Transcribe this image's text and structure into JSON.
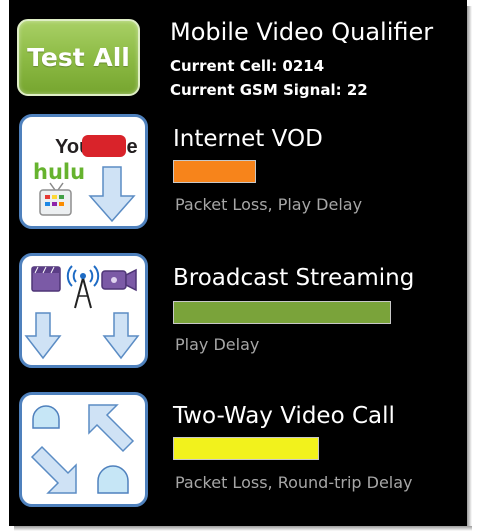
{
  "header": {
    "test_all_label": "Test All",
    "title": "Mobile Video Qualifier",
    "current_cell": "Current Cell: 0214",
    "current_signal": "Current GSM Signal: 22"
  },
  "services": [
    {
      "title": "Internet VOD",
      "quality": 0.32,
      "bar_color": "#f7841b",
      "metrics": "Packet Loss, Play Delay",
      "icon_logos": [
        "YouTube",
        "hulu"
      ]
    },
    {
      "title": "Broadcast Streaming",
      "quality": 0.84,
      "bar_color": "#7aa33a",
      "metrics": "Play Delay"
    },
    {
      "title": "Two-Way Video Call",
      "quality": 0.56,
      "bar_color": "#f2f21c",
      "metrics": "Packet Loss, Round-trip Delay"
    }
  ],
  "colors": {
    "background": "#000000",
    "tile_border": "#4f81bd",
    "arrow_fill": "#cfe2f5",
    "secondary_text": "#a6a6a6"
  },
  "icons": {
    "vod_tile": [
      "youtube-logo",
      "hulu-logo",
      "tv-icon",
      "arrow-down-icon"
    ],
    "broadcast_tile": [
      "film-clip-icon",
      "broadcast-tower-icon",
      "video-camera-icon",
      "arrow-down-icon",
      "arrow-down-icon"
    ],
    "twoway_tile": [
      "person-head-icon",
      "arrow-up-left-icon",
      "arrow-down-right-icon",
      "person-head-icon"
    ]
  }
}
